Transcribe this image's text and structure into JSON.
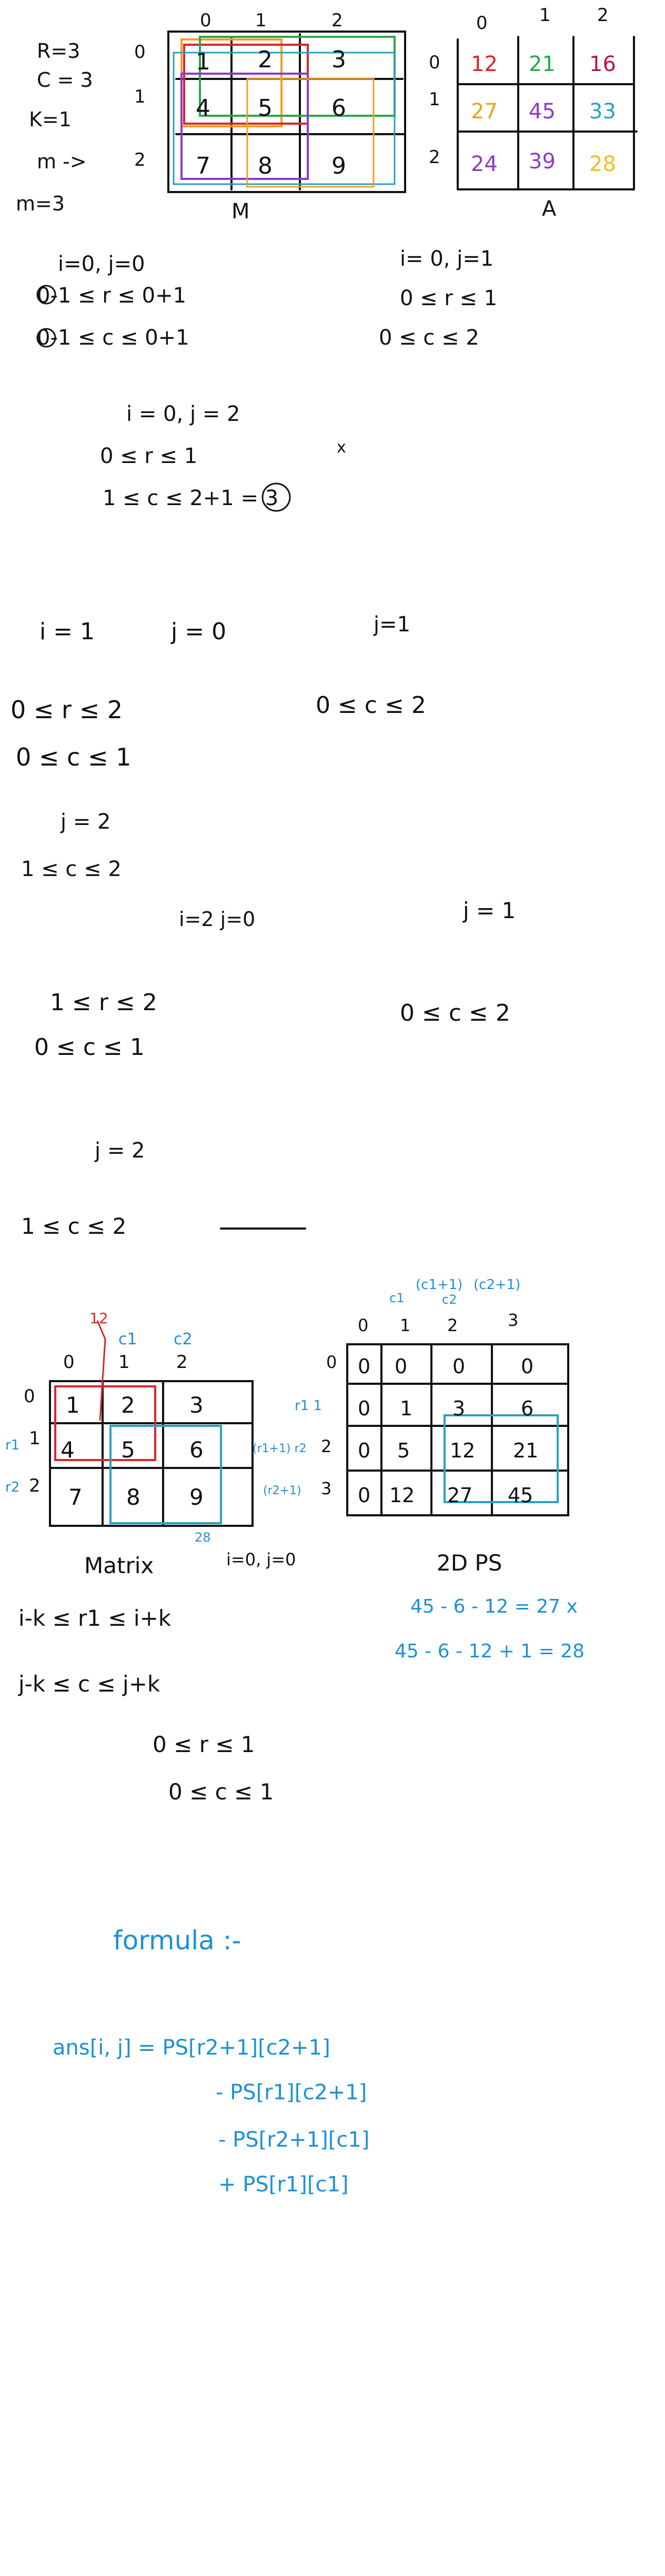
{
  "colors": {
    "ink": "#111111",
    "blue": "#1e90d6",
    "red": "#d9262b",
    "green": "#2aa84a",
    "orange": "#f0a020",
    "purple": "#8a3cc8",
    "teal": "#2aa0c0",
    "crimson": "#b8183a"
  },
  "top": {
    "params": [
      "R=3",
      "C = 3",
      "K=1",
      "m ->",
      "m=3"
    ],
    "m_index_cols": [
      "0",
      "1",
      "2"
    ],
    "m_index_rows": [
      "0",
      "1",
      "2"
    ],
    "m_values": [
      [
        "1",
        "2",
        "3"
      ],
      [
        "4",
        "5",
        "6"
      ],
      [
        "7",
        "8",
        "9"
      ]
    ],
    "m_caption": "M",
    "a_index_cols": [
      "0",
      "1",
      "2"
    ],
    "a_index_rows": [
      "0",
      "1",
      "2"
    ],
    "a_values": [
      [
        "12",
        "21",
        "16"
      ],
      [
        "27",
        "45",
        "33"
      ],
      [
        "24",
        "39",
        "28"
      ]
    ],
    "a_caption": "A"
  },
  "work1": {
    "left": [
      "i=0, j=0",
      "0-1 ≤ r ≤ 0+1",
      "0-1 ≤ c ≤ 0+1"
    ],
    "right": [
      "i= 0, j=1",
      "0 ≤ r ≤ 1",
      "0 ≤ c ≤ 2"
    ],
    "middle": [
      "i = 0, j = 2",
      "0 ≤ r ≤ 1",
      "1 ≤ c ≤ 2+1 = 3"
    ],
    "mark": "x"
  },
  "work2": {
    "row1": [
      "i = 1",
      "j = 0",
      "j=1"
    ],
    "line_a": "0 ≤ r ≤ 2",
    "line_b": "0 ≤ c ≤ 1",
    "line_c": "0 ≤ c ≤ 2",
    "j2": "j = 2",
    "line_d": "1 ≤ c ≤ 2",
    "i2": "i=2  j=0",
    "j1": "j = 1",
    "line_e": "1 ≤ r ≤ 2",
    "line_f": "0 ≤ c ≤ 1",
    "line_g": "0 ≤ c ≤ 2",
    "j2b": "j = 2",
    "line_h": "1 ≤ c ≤ 2"
  },
  "bottom": {
    "matrix_cols": [
      "0",
      "1",
      "2"
    ],
    "matrix_rows": [
      "0",
      "1",
      "2"
    ],
    "matrix_values": [
      [
        "1",
        "2",
        "3"
      ],
      [
        "4",
        "5",
        "6"
      ],
      [
        "7",
        "8",
        "9"
      ]
    ],
    "col_labels": [
      "c1",
      "c2"
    ],
    "row_labels": [
      "r1",
      "r2"
    ],
    "marker_12": "12",
    "marker_28": "28",
    "matrix_caption": "Matrix",
    "matrix_note": "i=0, j=0",
    "ps_cols": [
      "0",
      "1",
      "2",
      "3"
    ],
    "ps_rows": [
      "0",
      "1",
      "2",
      "3"
    ],
    "ps_values": [
      [
        "0",
        "0",
        "0",
        "0"
      ],
      [
        "0",
        "1",
        "3",
        "6"
      ],
      [
        "0",
        "5",
        "12",
        "21"
      ],
      [
        "0",
        "12",
        "27",
        "45"
      ]
    ],
    "ps_col_labels": [
      "(c1+1)",
      "(c2+1)",
      "c1",
      "c2"
    ],
    "ps_row_labels": [
      "r1 1",
      "(r1+1) r2",
      "(r2+1)"
    ],
    "ps_caption": "2D PS",
    "calc1": "45 - 6 - 12 = 27 x",
    "calc2": "45 - 6 - 12 + 1 = 28",
    "ineq1": "i-k ≤ r1 ≤ i+k",
    "ineq2": "j-k ≤ c ≤ j+k",
    "ineq3": "0 ≤ r ≤ 1",
    "ineq4": "0 ≤ c ≤ 1"
  },
  "formula": {
    "title": "formula :-",
    "lines": [
      "ans[i, j] = PS[r2+1][c2+1]",
      "- PS[r1][c2+1]",
      "- PS[r2+1][c1]",
      "+ PS[r1][c1]"
    ]
  }
}
